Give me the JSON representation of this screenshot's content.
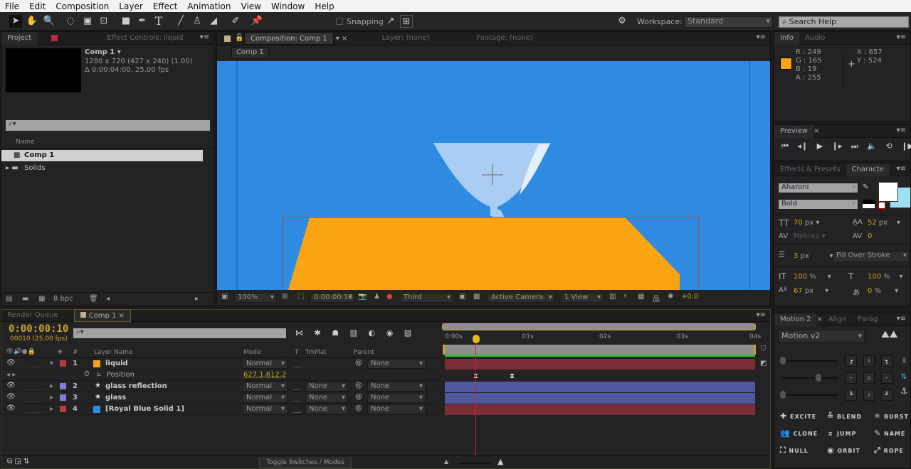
{
  "menu": [
    "File",
    "Edit",
    "Composition",
    "Layer",
    "Effect",
    "Animation",
    "View",
    "Window",
    "Help"
  ],
  "toolbar": {
    "snapping": "Snapping",
    "workspace_label": "Workspace:",
    "workspace": "Standard",
    "search_placeholder": "Search Help"
  },
  "project": {
    "tabs": [
      "Project",
      "Effect Controls: liquid"
    ],
    "comp_name": "Comp 1 ▾",
    "comp_size": "1280 x 720  (427 x 240) (1.00)",
    "comp_duration": "Δ 0:00:04:00, 25.00 fps",
    "column_name": "Name",
    "items": [
      "Comp 1",
      "Solids"
    ],
    "bpc": "8 bpc"
  },
  "composition": {
    "tabs": [
      "Composition: Comp 1",
      "Layer: (none)",
      "Footage: (none)"
    ],
    "breadcrumb": "Comp 1",
    "zoom": "100%",
    "time": "0:00:00:10",
    "resolution": "Third",
    "camera": "Active Camera",
    "views": "1 View",
    "exposure": "+0.0",
    "colors": {
      "background": "#2f8be2",
      "liquid": "#f9a513",
      "glass": "#a9cdf3"
    }
  },
  "info": {
    "tabs": [
      "Info",
      "Audio"
    ],
    "r": "R : 249",
    "g": "G : 165",
    "b": "B : 19",
    "a": "A : 255",
    "x": "X : 657",
    "y": "Y : 524",
    "swatch": "#f9a513"
  },
  "preview": {
    "tab": "Preview"
  },
  "character": {
    "tabs": [
      "Effects & Presets",
      "Characte"
    ],
    "font": "Aharoni",
    "style": "Bold",
    "size": "70",
    "size_unit": "px",
    "leading": "52",
    "leading_unit": "px",
    "kerning": "Metrics",
    "tracking": "0",
    "stroke": "3",
    "stroke_unit": "px",
    "stroke_mode": "Fill Over Stroke",
    "vscale": "100",
    "hscale": "100",
    "baseline": "67",
    "baseline_unit": "px",
    "tsume": "0",
    "pct": "%"
  },
  "timeline": {
    "tabs": [
      "Render Queue",
      "Comp 1"
    ],
    "timecode": "0:00:00:10",
    "frame": "00010 (25.00 fps)",
    "headers": {
      "layer_name": "Layer Name",
      "mode": "Mode",
      "t": "T",
      "trkmat": "TrkMat",
      "parent": "Parent"
    },
    "layers": [
      {
        "num": "1",
        "name": "liquid",
        "label": "#b83a45",
        "swatch": "#f9a513",
        "mode": "Normal",
        "trkmat": "",
        "parent": "None"
      },
      {
        "num": "2",
        "name": "glass reflection",
        "label": "#7a80d8",
        "swatch": "star",
        "mode": "Normal",
        "trkmat": "None",
        "parent": "None"
      },
      {
        "num": "3",
        "name": "glass",
        "label": "#7a80d8",
        "swatch": "star",
        "mode": "Normal",
        "trkmat": "None",
        "parent": "None"
      },
      {
        "num": "4",
        "name": "[Royal Blue Solid 1]",
        "label": "#b83a45",
        "swatch": "#2f8be2",
        "mode": "Normal",
        "trkmat": "None",
        "parent": "None"
      }
    ],
    "property": {
      "name": "Position",
      "value": "627.1,612.2"
    },
    "ruler": [
      "0:00s",
      "01s",
      "02s",
      "03s",
      "04s"
    ],
    "toggle": "Toggle Switches / Modes"
  },
  "motion2": {
    "tabs": [
      "Motion 2",
      "Align",
      "Parag"
    ],
    "preset": "Motion v2",
    "buttons": [
      "EXCITE",
      "BLEND",
      "BURST",
      "CLONE",
      "JUMP",
      "NAME",
      "NULL",
      "ORBIT",
      "ROPE"
    ]
  }
}
